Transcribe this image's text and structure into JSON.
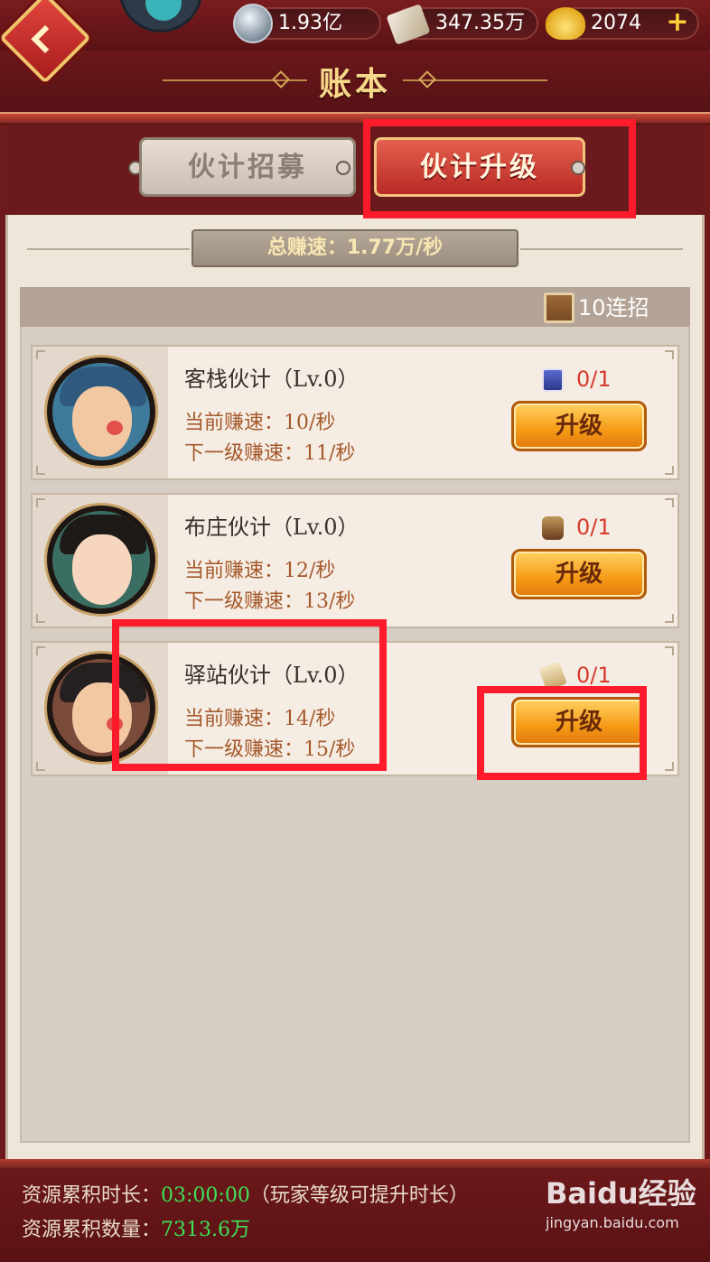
{
  "header": {
    "title": "账本",
    "resources": [
      {
        "name": "silver-coin-icon",
        "value": "1.93亿"
      },
      {
        "name": "book-icon",
        "value": "347.35万"
      },
      {
        "name": "gold-ingot-icon",
        "value": "2074"
      }
    ],
    "plus": "+"
  },
  "tabs": [
    {
      "label": "伙计招募",
      "active": false
    },
    {
      "label": "伙计升级",
      "active": true
    }
  ],
  "summary": {
    "total_speed": "总赚速：1.77万/秒"
  },
  "toolbar": {
    "ten_recruit_label": "10连招"
  },
  "partners": [
    {
      "name": "客栈伙计（Lv.0）",
      "current": "当前赚速：10/秒",
      "next": "下一级赚速：11/秒",
      "cost_icon": "card-icon",
      "cost": "0/1",
      "button": "升级"
    },
    {
      "name": "布庄伙计（Lv.0）",
      "current": "当前赚速：12/秒",
      "next": "下一级赚速：13/秒",
      "cost_icon": "cloth-roll-icon",
      "cost": "0/1",
      "button": "升级"
    },
    {
      "name": "驿站伙计（Lv.0）",
      "current": "当前赚速：14/秒",
      "next": "下一级赚速：15/秒",
      "cost_icon": "scroll-icon",
      "cost": "0/1",
      "button": "升级"
    }
  ],
  "footer": {
    "duration_label": "资源累积时长：",
    "duration_value": "03:00:00",
    "duration_note": "（玩家等级可提升时长）",
    "amount_label": "资源累积数量：",
    "amount_value": "7313.6万"
  },
  "watermark": {
    "logo": "Baidu经验",
    "url": "jingyan.baidu.com"
  },
  "colors": {
    "accent_red": "#b92a25",
    "highlight": "#ff1a2c",
    "button_orange": "#f59a16",
    "green": "#3ee05a"
  }
}
